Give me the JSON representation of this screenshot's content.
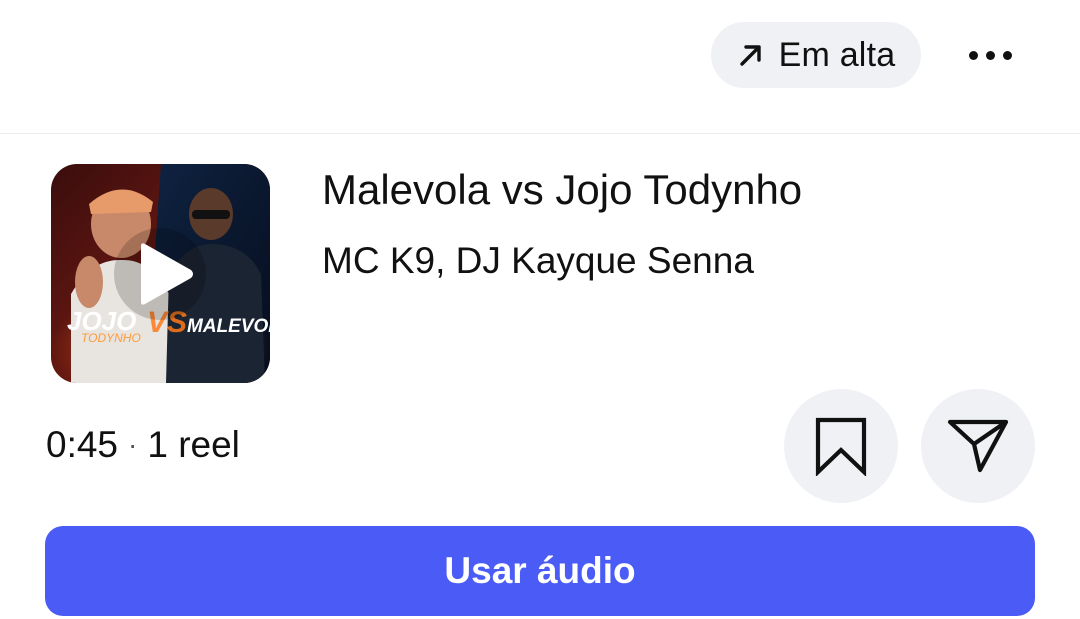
{
  "header": {
    "trending_label": "Em alta",
    "trending_icon": "arrow-up-right-icon",
    "more_icon": "more-horizontal-icon"
  },
  "track": {
    "title": "Malevola vs Jojo Todynho",
    "artists": "MC K9, DJ Kayque Senna",
    "duration": "0:45",
    "separator": "·",
    "reels": "1 reel",
    "cover_text_left": "JOJO",
    "cover_text_left_sub": "TODYNHO",
    "cover_text_vs": "VS",
    "cover_text_right": "MALEVOLA"
  },
  "actions": {
    "save_icon": "bookmark-icon",
    "share_icon": "send-icon",
    "use_audio_label": "Usar áudio"
  },
  "colors": {
    "primary": "#4a5cf5",
    "chip_background": "#eff1f4",
    "text": "#111111"
  }
}
